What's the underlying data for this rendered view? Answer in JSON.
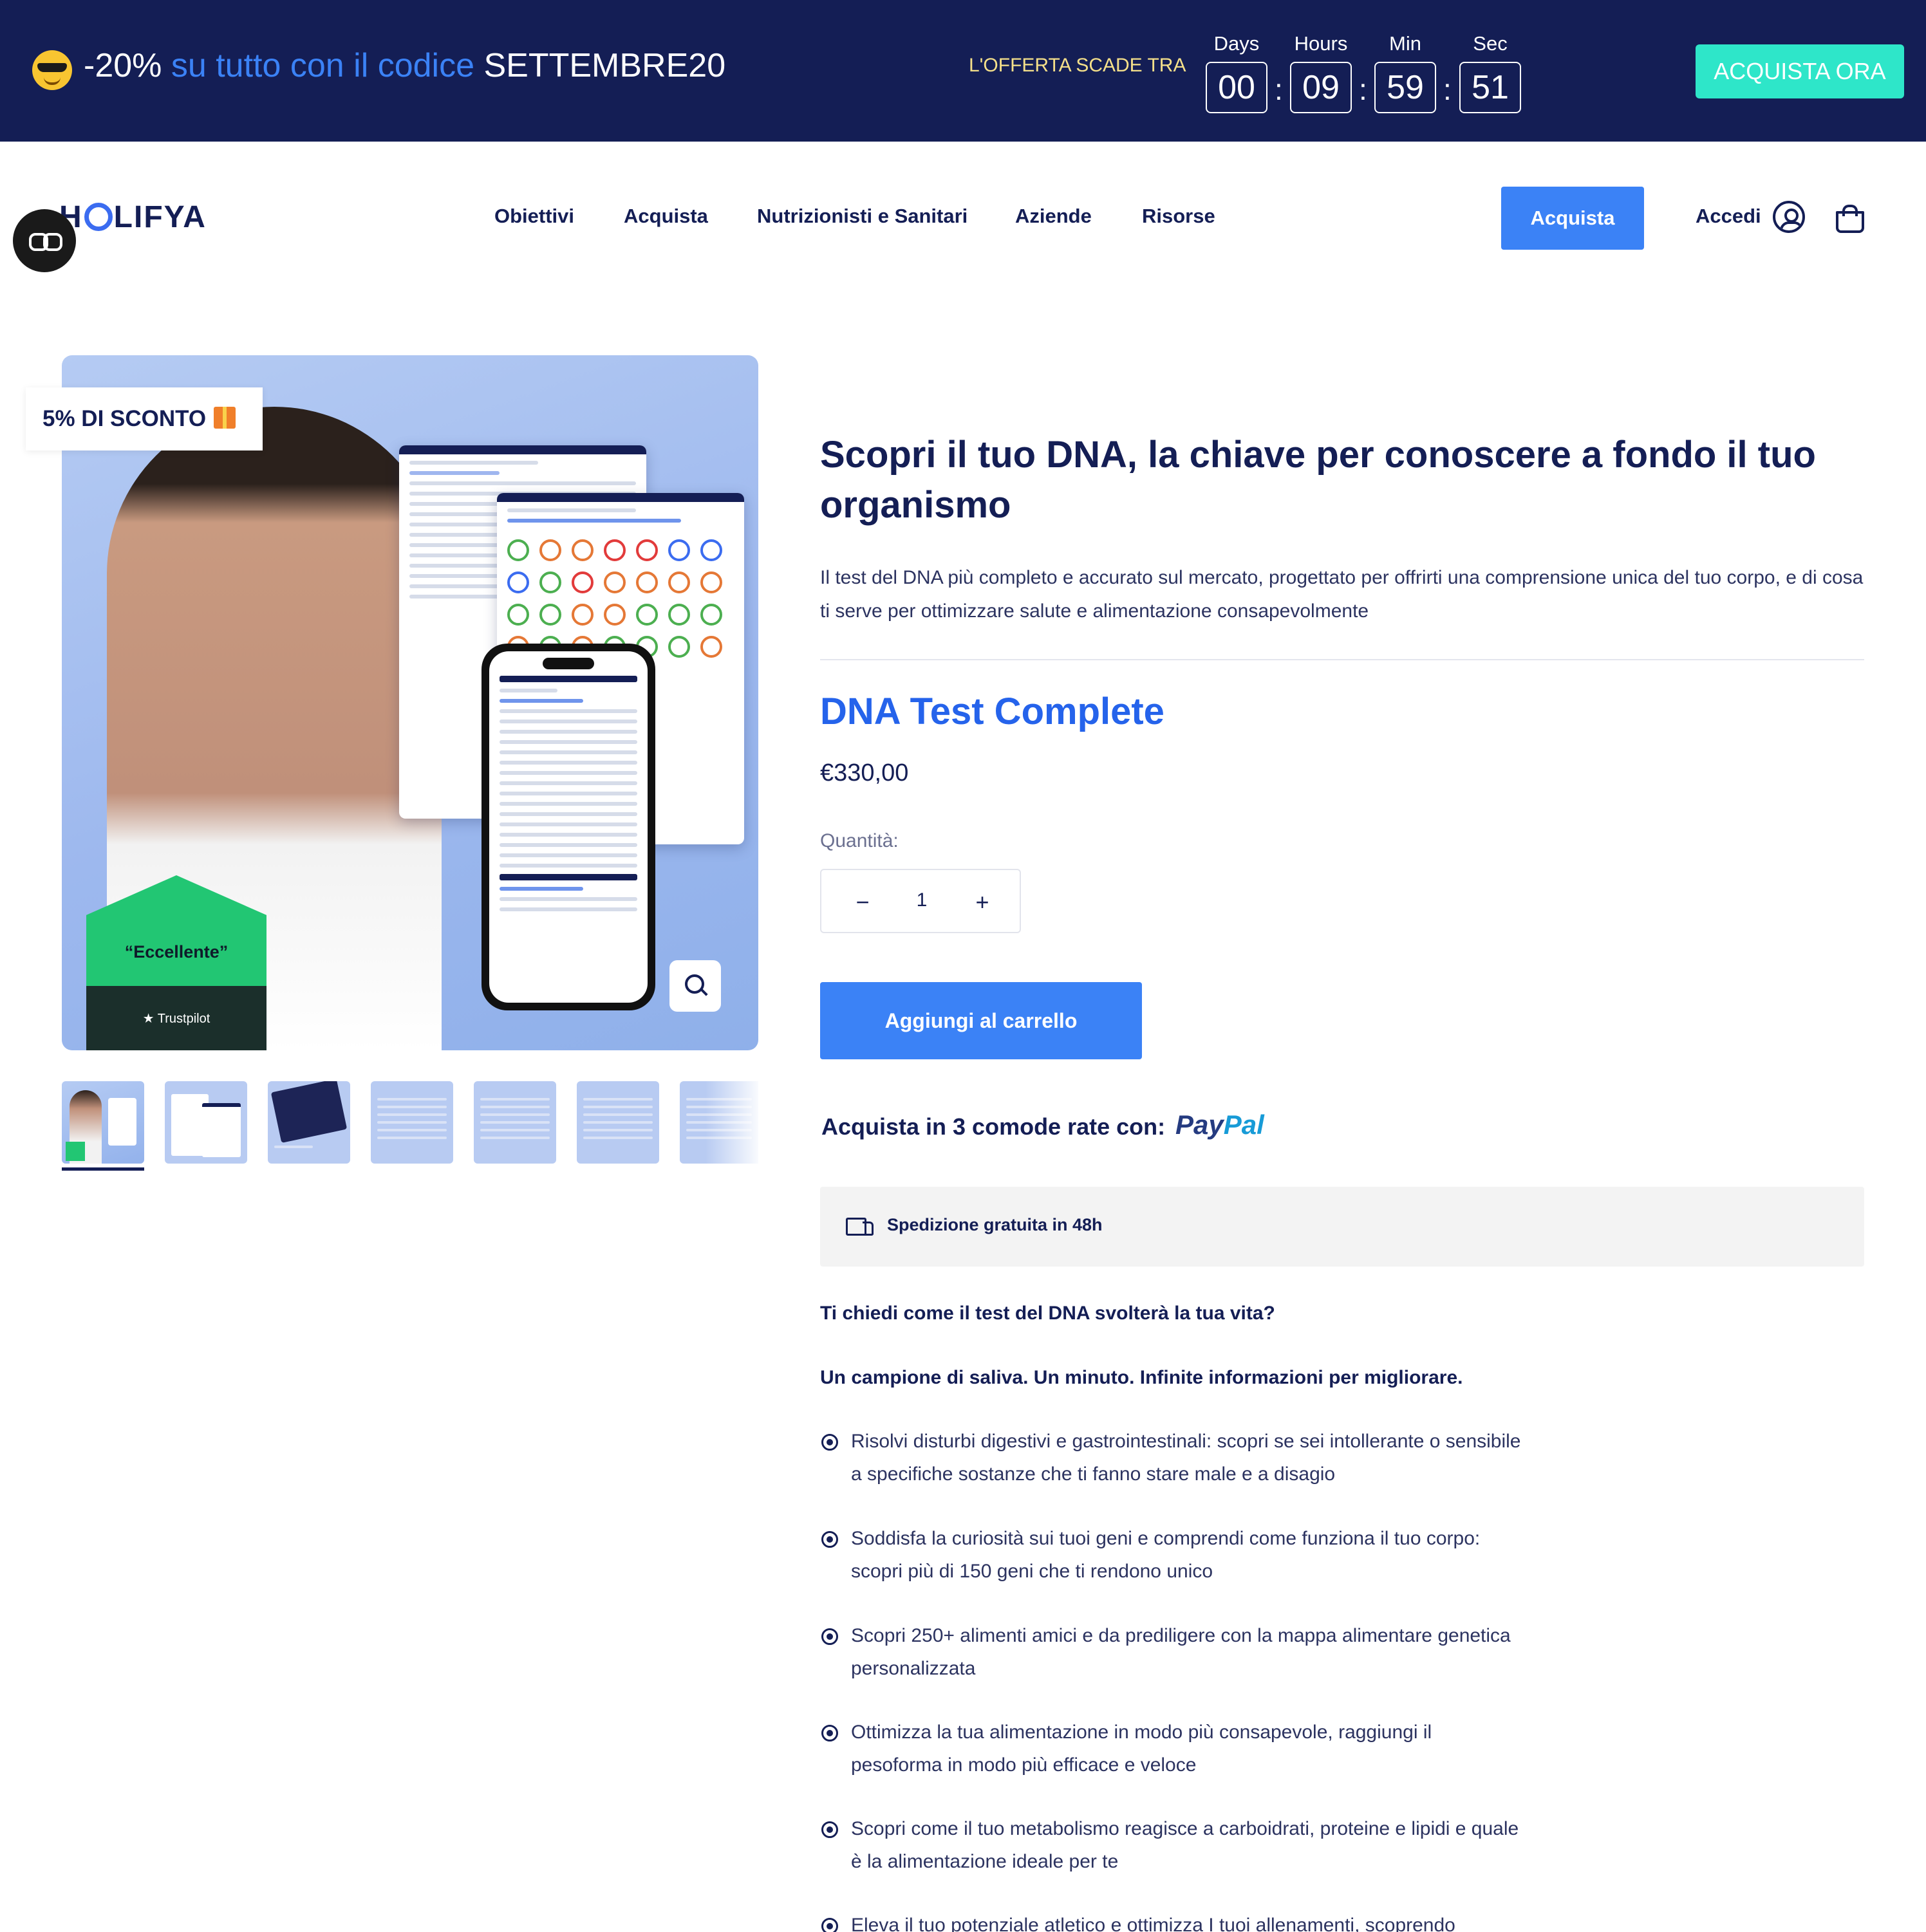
{
  "promo": {
    "text_a": "-20%",
    "text_b": "su tutto con il codice",
    "code": "SETTEMBRE20",
    "offer_label": "L'OFFERTA SCADE TRA",
    "countdown": [
      {
        "label": "Days",
        "value": "00"
      },
      {
        "label": "Hours",
        "value": "09"
      },
      {
        "label": "Min",
        "value": "59"
      },
      {
        "label": "Sec",
        "value": "51"
      }
    ],
    "cta": "ACQUISTA ORA"
  },
  "header": {
    "logo": "HOLIFYA",
    "nav": [
      "Obiettivi",
      "Acquista",
      "Nutrizionisti e Sanitari",
      "Aziende",
      "Risorse"
    ],
    "buy": "Acquista",
    "login": "Accedi"
  },
  "gallery": {
    "discount_tag": "5% DI SCONTO",
    "trust_label": "“Eccellente”",
    "trust_brand": "★ Trustpilot",
    "thumbnail_count": 7
  },
  "product": {
    "title": "Scopri il tuo DNA, la chiave per conoscere a fondo il tuo organismo",
    "description": "Il test del DNA più completo e accurato sul mercato, progettato per offrirti una comprensione unica del tuo corpo, e di cosa ti serve per ottimizzare salute e alimentazione consapevolmente",
    "name": "DNA Test Complete",
    "price": "€330,00",
    "quantity_label": "Quantità:",
    "quantity": "1",
    "add_to_cart": "Aggiungi al carrello",
    "installments": "Acquista in 3 comode rate con:",
    "paypal_a": "Pay",
    "paypal_b": "Pal",
    "shipping": "Spedizione gratuita in 48h",
    "question": "Ti chiedi come il test del DNA svolterà la tua vita?",
    "tagline": "Un campione di saliva. Un minuto. Infinite informazioni per migliorare.",
    "bullets": [
      "Risolvi disturbi digestivi e gastrointestinali: scopri se sei intollerante o sensibile a specifiche sostanze che ti fanno stare male e a disagio",
      "Soddisfa la curiosità sui tuoi geni e comprendi come funziona il tuo corpo: scopri più di 150 geni che ti rendono unico",
      "Scopri 250+ alimenti amici e da prediligere con la mappa alimentare genetica personalizzata",
      "Ottimizza la tua alimentazione in modo più consapevole, raggiungi il pesoforma in modo più efficace e veloce",
      "Scopri come il tuo metabolismo reagisce a carboidrati, proteine e lipidi e quale è la alimentazione ideale per te",
      "Eleva il tuo potenziale atletico e ottimizza I tuoi allenamenti, scoprendo"
    ]
  },
  "colors": {
    "navy": "#141e55",
    "accent_blue": "#3b82f6",
    "teal_cta": "#2ee6c9",
    "trustpilot_green": "#22c673"
  },
  "icons": [
    "sunglasses-emoji-icon",
    "accessibility-icon",
    "user-icon",
    "cart-icon",
    "gift-icon",
    "zoom-icon",
    "truck-icon",
    "radio-bullet-icon"
  ]
}
